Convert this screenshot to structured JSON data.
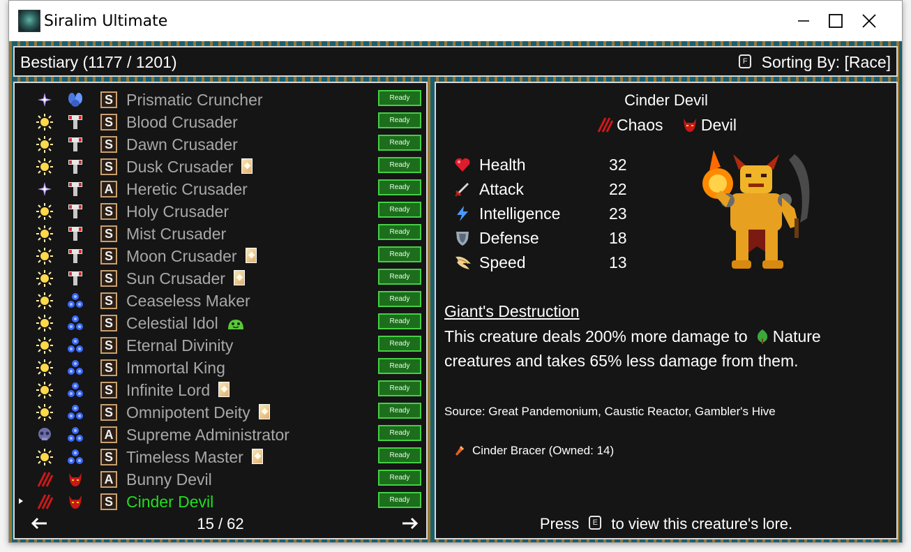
{
  "window": {
    "title": "Siralim Ultimate"
  },
  "header": {
    "title": "Bestiary (1177 / 1201)",
    "sort_key": "F",
    "sort_label": "Sorting By: [Race]"
  },
  "list": {
    "rows": [
      {
        "name": "Prismatic Cruncher",
        "class_icon": "sparkle-icon",
        "race_icon": "cruncher-race-icon",
        "rank": "S",
        "badge": "",
        "status": "Ready",
        "selected": false
      },
      {
        "name": "Blood Crusader",
        "class_icon": "sun-icon",
        "race_icon": "crusader-race-icon",
        "rank": "S",
        "badge": "",
        "status": "Ready",
        "selected": false
      },
      {
        "name": "Dawn Crusader",
        "class_icon": "sun-icon",
        "race_icon": "crusader-race-icon",
        "rank": "S",
        "badge": "",
        "status": "Ready",
        "selected": false
      },
      {
        "name": "Dusk Crusader",
        "class_icon": "sun-icon",
        "race_icon": "crusader-race-icon",
        "rank": "S",
        "badge": "card",
        "status": "Ready",
        "selected": false
      },
      {
        "name": "Heretic Crusader",
        "class_icon": "sparkle-icon",
        "race_icon": "crusader-race-icon",
        "rank": "A",
        "badge": "",
        "status": "Ready",
        "selected": false
      },
      {
        "name": "Holy Crusader",
        "class_icon": "sun-icon",
        "race_icon": "crusader-race-icon",
        "rank": "S",
        "badge": "",
        "status": "Ready",
        "selected": false
      },
      {
        "name": "Mist Crusader",
        "class_icon": "sun-icon",
        "race_icon": "crusader-race-icon",
        "rank": "S",
        "badge": "",
        "status": "Ready",
        "selected": false
      },
      {
        "name": "Moon Crusader",
        "class_icon": "sun-icon",
        "race_icon": "crusader-race-icon",
        "rank": "S",
        "badge": "card",
        "status": "Ready",
        "selected": false
      },
      {
        "name": "Sun Crusader",
        "class_icon": "sun-icon",
        "race_icon": "crusader-race-icon",
        "rank": "S",
        "badge": "card",
        "status": "Ready",
        "selected": false
      },
      {
        "name": "Ceaseless Maker",
        "class_icon": "sun-icon",
        "race_icon": "deity-race-icon",
        "rank": "S",
        "badge": "",
        "status": "Ready",
        "selected": false
      },
      {
        "name": "Celestial Idol",
        "class_icon": "sun-icon",
        "race_icon": "deity-race-icon",
        "rank": "S",
        "badge": "slime",
        "status": "Ready",
        "selected": false
      },
      {
        "name": "Eternal Divinity",
        "class_icon": "sun-icon",
        "race_icon": "deity-race-icon",
        "rank": "S",
        "badge": "",
        "status": "Ready",
        "selected": false
      },
      {
        "name": "Immortal King",
        "class_icon": "sun-icon",
        "race_icon": "deity-race-icon",
        "rank": "S",
        "badge": "",
        "status": "Ready",
        "selected": false
      },
      {
        "name": "Infinite Lord",
        "class_icon": "sun-icon",
        "race_icon": "deity-race-icon",
        "rank": "S",
        "badge": "card",
        "status": "Ready",
        "selected": false
      },
      {
        "name": "Omnipotent Deity",
        "class_icon": "sun-icon",
        "race_icon": "deity-race-icon",
        "rank": "S",
        "badge": "card",
        "status": "Ready",
        "selected": false
      },
      {
        "name": "Supreme Administrator",
        "class_icon": "skull-icon",
        "race_icon": "deity-race-icon",
        "rank": "A",
        "badge": "",
        "status": "Ready",
        "selected": false
      },
      {
        "name": "Timeless Master",
        "class_icon": "sun-icon",
        "race_icon": "deity-race-icon",
        "rank": "S",
        "badge": "card",
        "status": "Ready",
        "selected": false
      },
      {
        "name": "Bunny Devil",
        "class_icon": "chaos-icon",
        "race_icon": "devil-race-icon",
        "rank": "A",
        "badge": "",
        "status": "Ready",
        "selected": false
      },
      {
        "name": "Cinder Devil",
        "class_icon": "chaos-icon",
        "race_icon": "devil-race-icon",
        "rank": "S",
        "badge": "",
        "status": "Ready",
        "selected": true
      }
    ],
    "pager": {
      "label": "15 / 62"
    }
  },
  "detail": {
    "name": "Cinder Devil",
    "class": "Chaos",
    "race": "Devil",
    "stats": [
      {
        "label": "Health",
        "value": "32",
        "icon": "heart-icon"
      },
      {
        "label": "Attack",
        "value": "22",
        "icon": "sword-icon"
      },
      {
        "label": "Intelligence",
        "value": "23",
        "icon": "lightning-icon"
      },
      {
        "label": "Defense",
        "value": "18",
        "icon": "shield-icon"
      },
      {
        "label": "Speed",
        "value": "13",
        "icon": "wing-icon"
      }
    ],
    "trait": {
      "name": "Giant's Destruction",
      "desc_before": "This creature deals 200% more damage to",
      "desc_class": "Nature",
      "desc_after": "creatures and takes 65% less damage from them."
    },
    "source": "Source: Great Pandemonium, Caustic Reactor, Gambler's Hive",
    "item": "Cinder Bracer (Owned: 14)",
    "lore": {
      "before": "Press",
      "key": "E",
      "after": "to view this creature's lore."
    }
  },
  "colors": {
    "ready_fill": "#1c6e1c",
    "selected_name": "#22dd22",
    "name": "#a8a8a8"
  }
}
